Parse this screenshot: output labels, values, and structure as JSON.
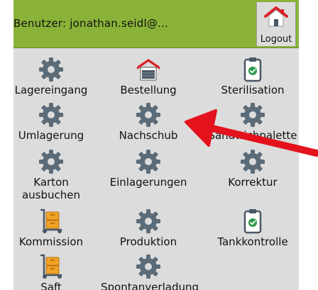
{
  "header": {
    "user_label": "Benutzer: jonathan.seidl@...",
    "logout_label": "Logout"
  },
  "menu": {
    "items": [
      {
        "label": "Lagereingang",
        "icon": "gear-icon"
      },
      {
        "label": "Bestellung",
        "icon": "garage-icon"
      },
      {
        "label": "Sterilisation",
        "icon": "clipboard-check-icon"
      },
      {
        "label": "Umlagerung",
        "icon": "gear-icon"
      },
      {
        "label": "Nachschub",
        "icon": "gear-icon"
      },
      {
        "label": "Sandwichpalette",
        "icon": "gear-icon"
      },
      {
        "label": "Karton\nausbuchen",
        "icon": "gear-icon"
      },
      {
        "label": "Einlagerungen",
        "icon": "gear-icon"
      },
      {
        "label": "Korrektur",
        "icon": "gear-icon"
      },
      {
        "label": "Kommission",
        "icon": "hand-truck-icon"
      },
      {
        "label": "Produktion",
        "icon": "gear-icon"
      },
      {
        "label": "Tankkontrolle",
        "icon": "clipboard-check-icon"
      },
      {
        "label": "Saft",
        "icon": "hand-truck-icon"
      },
      {
        "label": "Spontanverladung",
        "icon": "gear-icon"
      }
    ]
  },
  "colors": {
    "header_bg": "#8ab238",
    "page_bg": "#dcdcdc",
    "icon_gray": "#5b6b78",
    "arrow_red": "#e3121c",
    "check_green": "#2e9b4e",
    "box_orange": "#f2a227"
  }
}
